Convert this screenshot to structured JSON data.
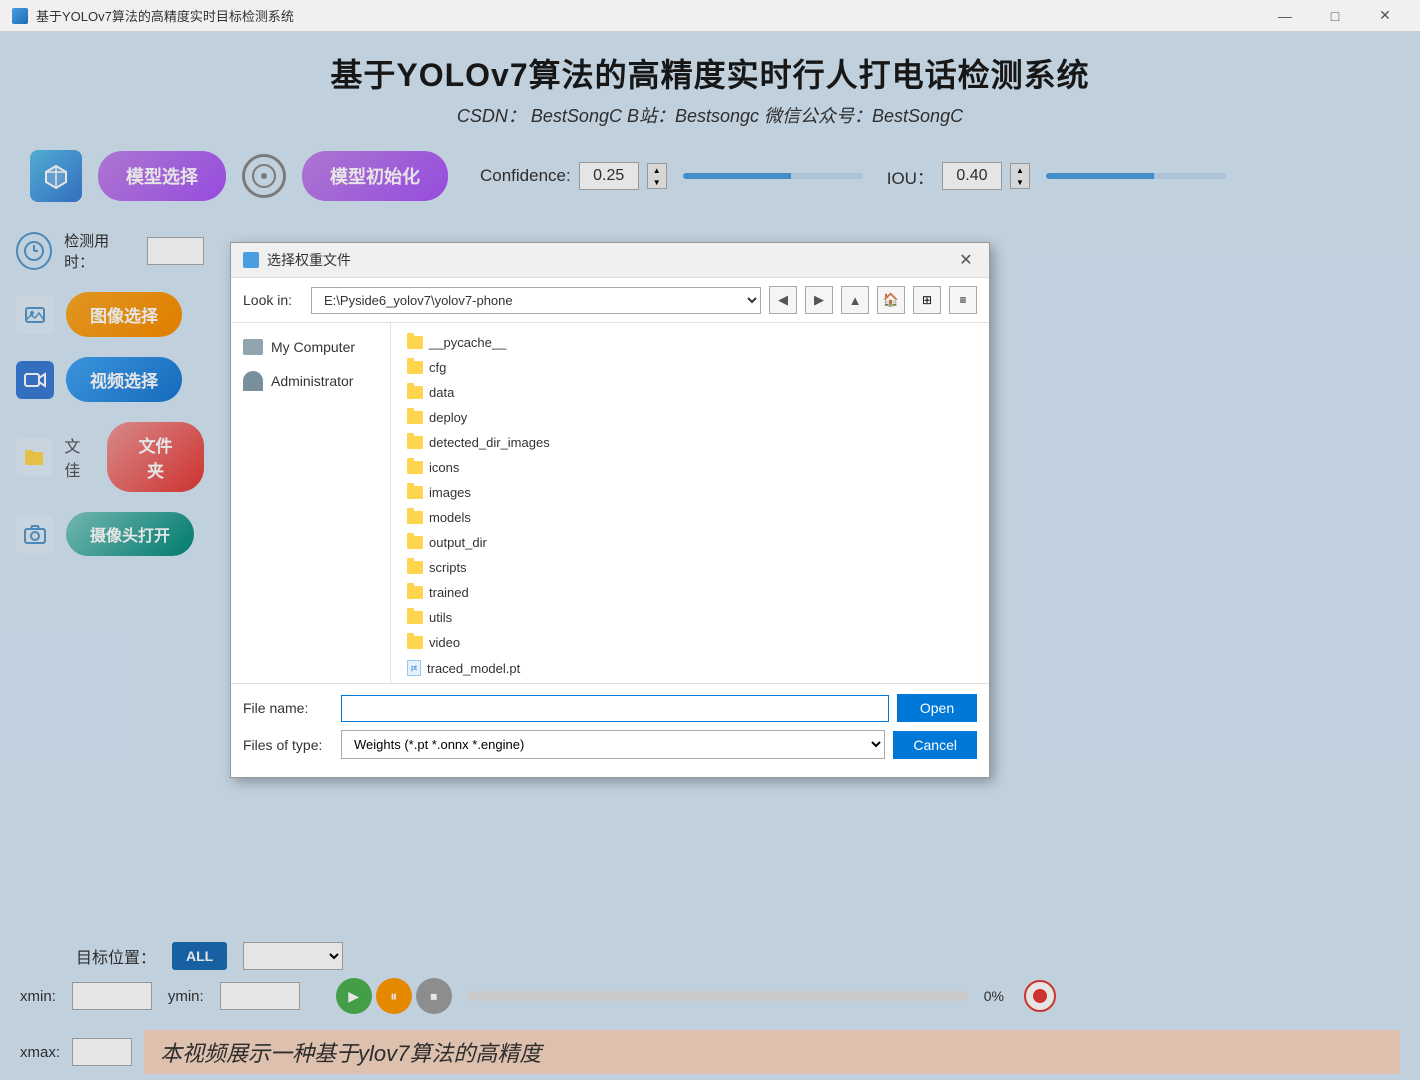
{
  "titleBar": {
    "title": "基于YOLOv7算法的高精度实时目标检测系统",
    "minimize": "—",
    "maximize": "□",
    "close": "✕"
  },
  "appHeader": {
    "title": "基于YOLOv7算法的高精度实时行人打电话检测系统",
    "subtitle": "CSDN： BestSongC  B站：Bestsongc  微信公众号：BestSongC"
  },
  "toolbar": {
    "modelSelectLabel": "模型选择",
    "modelInitLabel": "模型初始化",
    "confidenceLabel": "Confidence:",
    "confidenceValue": "0.25",
    "iouLabel": "IOU：",
    "iouValue": "0.40"
  },
  "sidebar": {
    "timeLabel": "检测用时：",
    "imageSelectLabel": "图像选择",
    "videoSelectLabel": "视频选择",
    "folderLabel": "文件夹",
    "folderSideLabel": "文佳",
    "cameraLabel": "摄像头打开"
  },
  "fileDialog": {
    "title": "选择权重文件",
    "lookInLabel": "Look in:",
    "lookInPath": "E:\\Pyside6_yolov7\\yolov7-phone",
    "sidebarItems": [
      {
        "label": "My Computer"
      },
      {
        "label": "Administrator"
      }
    ],
    "folders": [
      "__pycache__",
      "cfg",
      "data",
      "deploy",
      "detected_dir_images",
      "icons",
      "images",
      "models",
      "output_dir",
      "scripts",
      "trained",
      "utils",
      "video"
    ],
    "files": [
      "traced_model.pt"
    ],
    "fileNameLabel": "File name:",
    "fileNameValue": "",
    "filesOfTypeLabel": "Files of type:",
    "filesOfTypeValue": "Weights (*.pt *.onnx *.engine)",
    "openLabel": "Open",
    "cancelLabel": "Cancel"
  },
  "bottomBar": {
    "targetPosLabel": "目标位置：",
    "allLabel": "ALL",
    "xminLabel": "xmin:",
    "yminLabel": "ymin:",
    "xmaxLabel": "xmax:",
    "progressPercent": "0%",
    "marqueeText": "本视频展示一种基于ylov7算法的高精度"
  }
}
